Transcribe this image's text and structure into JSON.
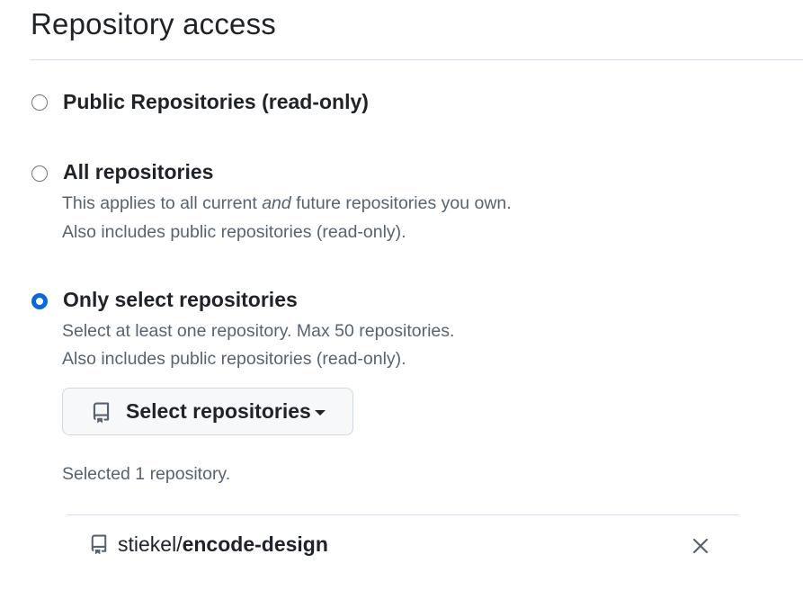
{
  "section": {
    "title": "Repository access"
  },
  "options": [
    {
      "label": "Public Repositories (read-only)",
      "checked": false
    },
    {
      "label": "All repositories",
      "checked": false,
      "description_line1_pre": "This applies to all current ",
      "description_line1_em": "and",
      "description_line1_post": " future repositories you own.",
      "description_line2": "Also includes public repositories (read-only)."
    },
    {
      "label": "Only select repositories",
      "checked": true,
      "description_line1": "Select at least one repository. Max 50 repositories.",
      "description_line2": "Also includes public repositories (read-only)."
    }
  ],
  "select_button": {
    "label": "Select repositories",
    "icon": "repo-icon",
    "caret_icon": "triangle-down-icon"
  },
  "selected_summary": "Selected 1 repository.",
  "repositories": [
    {
      "owner": "stiekel/",
      "name": "encode-design",
      "icon": "repo-icon",
      "remove_icon": "x-icon"
    }
  ],
  "colors": {
    "accent": "#0969da",
    "text": "#1f2328",
    "muted": "#59636e",
    "border": "#d8dee4",
    "button_bg": "#f6f8fa"
  }
}
